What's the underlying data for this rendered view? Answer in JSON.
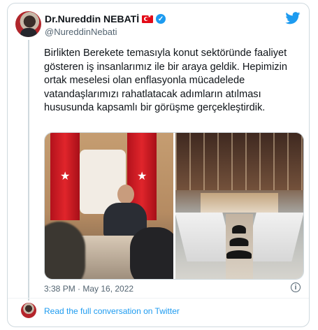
{
  "author": {
    "name": "Dr.Nureddin NEBATİ",
    "handle": "@NureddinNebati",
    "flag_icon": "turkey-flag-icon",
    "verified_icon": "verified-badge-icon"
  },
  "tweet": {
    "text": "Birlikten Berekete temasıyla konut sektöründe faaliyet gösteren iş insanlarımız ile bir araya geldik. Hepimizin ortak meselesi olan enflasyonla mücadelede vatandaşlarımızı rahatlatacak adımların atılması hususunda kapsamlı bir görüşme gerçekleştirdik.",
    "timestamp": "3:38 PM · May 16, 2022"
  },
  "actions": {
    "conversation_link": "Read the full conversation on Twitter"
  },
  "colors": {
    "accent": "#1d9bf0",
    "text": "#0f1419",
    "muted": "#536471",
    "border": "#cfd9de"
  }
}
